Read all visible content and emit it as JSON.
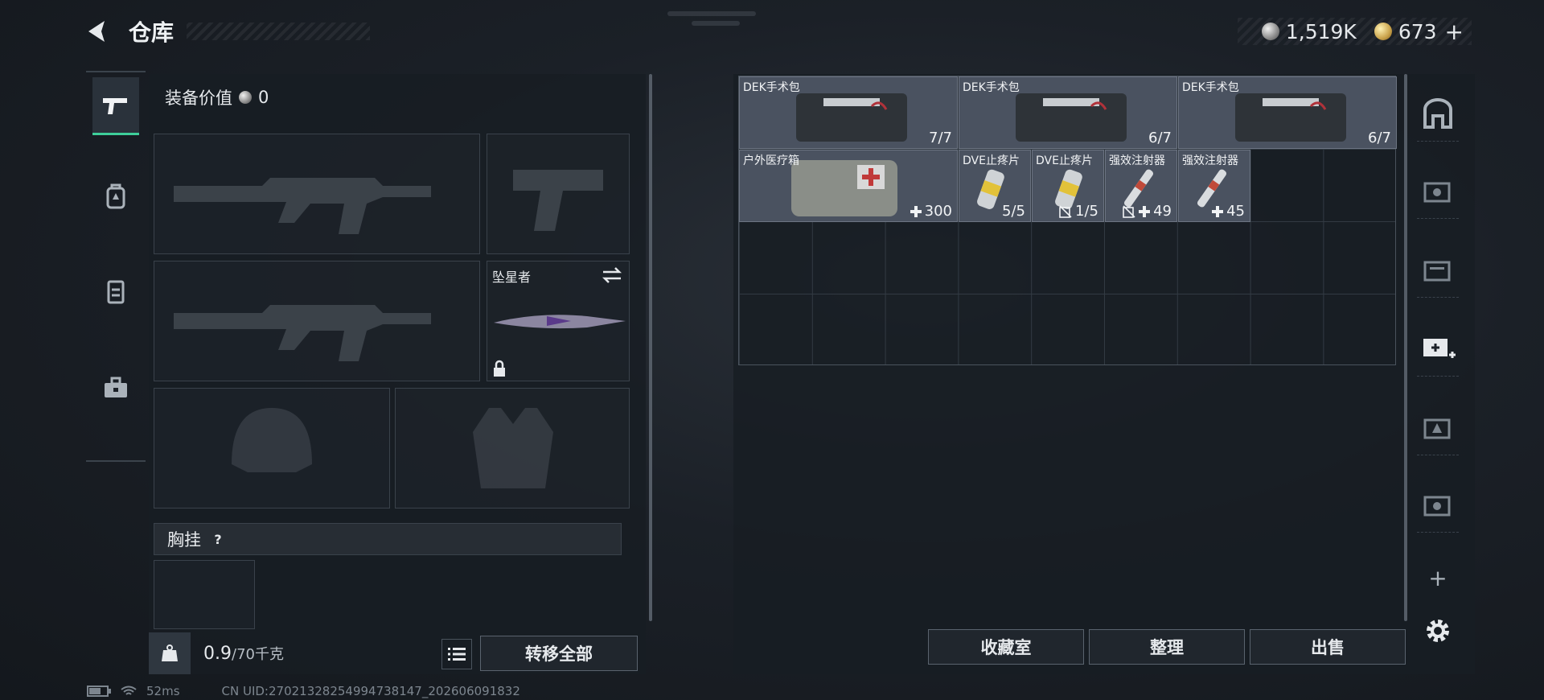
{
  "header": {
    "title": "仓库"
  },
  "currency": {
    "silver_value": "1,519K",
    "gold_value": "673",
    "plus": "+"
  },
  "left_panel": {
    "equip_value_label": "装备价值",
    "equip_value": "0",
    "melee_slot_name": "坠星者",
    "chest_rig_label": "胸挂",
    "help": "?",
    "weight_current": "0.9",
    "weight_max": "/70千克",
    "transfer_all": "转移全部"
  },
  "storage": {
    "items": [
      {
        "name": "DEK手术包",
        "count": "7/7"
      },
      {
        "name": "DEK手术包",
        "count": "6/7"
      },
      {
        "name": "DEK手术包",
        "count": "6/7"
      },
      {
        "name": "户外医疗箱",
        "count": "300"
      },
      {
        "name": "DVE止疼片",
        "count": "5/5"
      },
      {
        "name": "DVE止疼片",
        "count": "1/5"
      },
      {
        "name": "强效注射器",
        "count": "49"
      },
      {
        "name": "强效注射器",
        "count": "45"
      }
    ],
    "buttons": {
      "collection": "收藏室",
      "organize": "整理",
      "sell": "出售"
    }
  },
  "status_bar": {
    "ping": "52ms",
    "uid": "CN UID:27021328254994738147_202606091832"
  },
  "colors": {
    "accent": "#3ecf9a",
    "panel": "#181d23",
    "item": "#4a5260"
  },
  "icons": [
    "back-arrow-icon",
    "silver-coin-icon",
    "gold-coin-icon",
    "pistol-icon",
    "backpack-icon",
    "armor-icon",
    "toolbox-icon",
    "weight-icon",
    "list-icon",
    "swap-icon",
    "lock-icon",
    "vault-icon",
    "storage-icon",
    "add-storage-icon",
    "settings-icon"
  ]
}
